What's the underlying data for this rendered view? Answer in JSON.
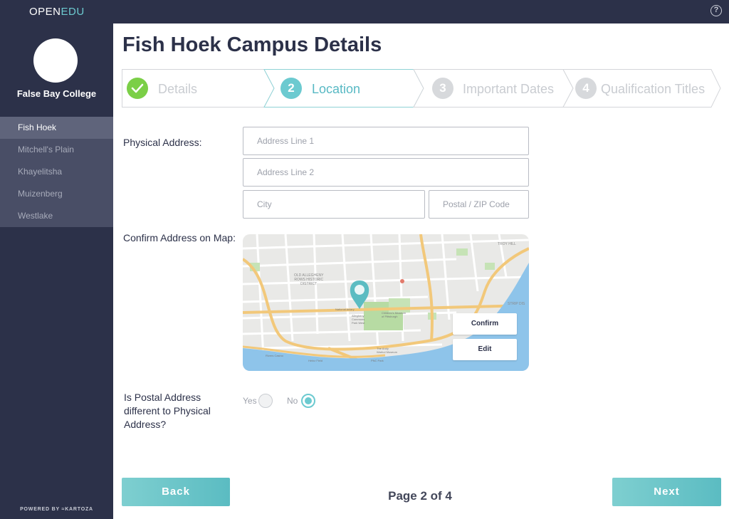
{
  "app": {
    "brand_main": "OPEN",
    "brand_accent": "EDU",
    "help_icon": "?"
  },
  "sidebar": {
    "college_name": "False Bay College",
    "campuses": [
      {
        "label": "Fish Hoek",
        "active": true
      },
      {
        "label": "Mitchell's Plain",
        "active": false
      },
      {
        "label": "Khayelitsha",
        "active": false
      },
      {
        "label": "Muizenberg",
        "active": false
      },
      {
        "label": "Westlake",
        "active": false
      }
    ],
    "powered_by": "POWERED BY",
    "powered_brand": "KARTOZA"
  },
  "page": {
    "title": "Fish Hoek Campus Details",
    "steps": [
      {
        "number": "",
        "label": "Details",
        "state": "done",
        "icon": "check-icon"
      },
      {
        "number": "2",
        "label": "Location",
        "state": "current"
      },
      {
        "number": "3",
        "label": "Important Dates",
        "state": "upcoming"
      },
      {
        "number": "4",
        "label": "Qualification Titles",
        "state": "upcoming"
      }
    ]
  },
  "form": {
    "physical_address_label": "Physical Address:",
    "address_line1_placeholder": "Address Line 1",
    "address_line2_placeholder": "Address Line 2",
    "city_placeholder": "City",
    "postal_placeholder": "Postal / ZIP Code",
    "map_label": "Confirm Address on Map:",
    "map_confirm": "Confirm",
    "map_edit": "Edit",
    "postal_question": "Is Postal Address different to Physical Address?",
    "yes_label": "Yes",
    "no_label": "No",
    "selected": "No"
  },
  "map_labels": {
    "district": "OLD ALLEGHENY\nROWS HISTORIC\nDISTRICT",
    "troy_hill": "TROY HILL",
    "strip": "STRIP DIS",
    "aviary": "National Aviary",
    "childrens": "Children's Museum\nof Pittsburgh",
    "allegheny": "Allegheny\nCommons\nPark West",
    "andy": "The Andy\nWarhol Museum",
    "heinz": "Heinz Field",
    "pnc": "PNC Park",
    "casino": "Rivers Casino"
  },
  "footer": {
    "back": "Back",
    "next": "Next",
    "page_indicator": "Page 2 of 4"
  },
  "colors": {
    "navy": "#2c3149",
    "teal": "#6ccad0",
    "green": "#7bcf47"
  }
}
